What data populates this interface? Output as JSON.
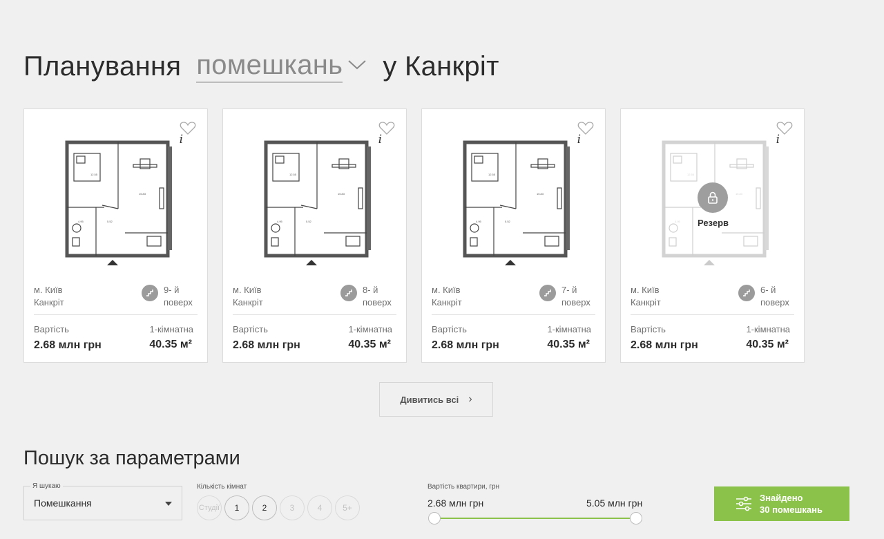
{
  "heading": {
    "prefix": "Планування",
    "selected_type": "помешкань",
    "suffix": "у Канкріт"
  },
  "cards": [
    {
      "city": "м. Київ",
      "complex": "Канкріт",
      "floor_num": "9- й",
      "floor_word": "поверх",
      "price_label": "Вартість",
      "price": "2.68 млн грн",
      "rooms": "1-кімнатна",
      "area": "40.35 м²",
      "reserved": false
    },
    {
      "city": "м. Київ",
      "complex": "Канкріт",
      "floor_num": "8- й",
      "floor_word": "поверх",
      "price_label": "Вартість",
      "price": "2.68 млн грн",
      "rooms": "1-кімнатна",
      "area": "40.35 м²",
      "reserved": false
    },
    {
      "city": "м. Київ",
      "complex": "Канкріт",
      "floor_num": "7- й",
      "floor_word": "поверх",
      "price_label": "Вартість",
      "price": "2.68 млн грн",
      "rooms": "1-кімнатна",
      "area": "40.35 м²",
      "reserved": false
    },
    {
      "city": "м. Київ",
      "complex": "Канкріт",
      "floor_num": "6- й",
      "floor_word": "поверх",
      "price_label": "Вартість",
      "price": "2.68 млн грн",
      "rooms": "1-кімнатна",
      "area": "40.35 м²",
      "reserved": true,
      "reserved_label": "Резерв"
    }
  ],
  "card_info_glyph": "i",
  "view_all": {
    "label": "Дивитись всі",
    "arrow": "›"
  },
  "search": {
    "title": "Пошук за параметрами",
    "looking_for_label": "Я шукаю",
    "looking_for_value": "Помешкання",
    "rooms_label": "Кількість кімнат",
    "room_options": [
      {
        "label": "Студії",
        "enabled": false
      },
      {
        "label": "1",
        "enabled": true
      },
      {
        "label": "2",
        "enabled": true
      },
      {
        "label": "3",
        "enabled": false
      },
      {
        "label": "4",
        "enabled": false
      },
      {
        "label": "5+",
        "enabled": false
      }
    ],
    "price_label": "Вартість квартири, грн",
    "price_min": "2.68 млн грн",
    "price_max": "5.05 млн грн",
    "found_line1": "Знайдено",
    "found_line2": "30 помешкань"
  },
  "colors": {
    "accent": "#8bc34a",
    "background": "#f0f0f0",
    "text": "#2b2b2b",
    "muted": "#6f6f6f"
  },
  "icons": [
    "chevron-down-icon",
    "heart-icon",
    "info-icon",
    "stairs-icon",
    "lock-icon",
    "chevron-right-icon",
    "filter-sliders-icon",
    "caret-down-icon"
  ]
}
